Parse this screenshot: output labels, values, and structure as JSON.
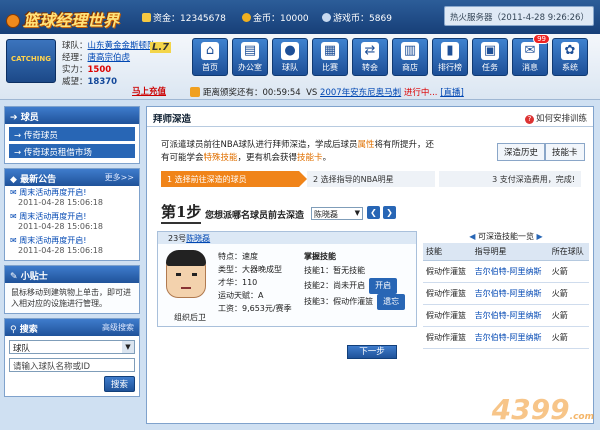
{
  "topbar": {
    "logo": "篮球经理世界",
    "funds_label": "资金：",
    "funds_value": "12345678",
    "gold_label": "金币：",
    "gold_value": "10000",
    "coins_label": "游戏币：",
    "coins_value": "5869",
    "server": "热火服务器（2011-4-28 9:26:26）"
  },
  "club": {
    "avatar_text": "CATCHING",
    "team_label": "球队：",
    "team_name": "山东黄金金斯顿队",
    "level": "L.7",
    "manager_label": "经理：",
    "manager_name": "唐高宗伯虎",
    "strength_label": "实力：",
    "strength_value": "1500",
    "prestige_label": "威望：",
    "prestige_value": "18370",
    "go_link": "马上充值"
  },
  "nav": [
    {
      "label": "首页",
      "icon": "home-icon",
      "glyph": "⌂"
    },
    {
      "label": "办公室",
      "icon": "office-icon",
      "glyph": "▤"
    },
    {
      "label": "球队",
      "icon": "basketball-icon",
      "glyph": "●"
    },
    {
      "label": "比赛",
      "icon": "match-icon",
      "glyph": "▦"
    },
    {
      "label": "转会",
      "icon": "transfer-icon",
      "glyph": "⇄"
    },
    {
      "label": "商店",
      "icon": "shop-icon",
      "glyph": "▥"
    },
    {
      "label": "排行榜",
      "icon": "ranking-icon",
      "glyph": "▮"
    },
    {
      "label": "任务",
      "icon": "task-icon",
      "glyph": "▣"
    },
    {
      "label": "消息",
      "icon": "message-icon",
      "glyph": "✉",
      "badge": "99"
    },
    {
      "label": "系统",
      "icon": "system-icon",
      "glyph": "✿"
    }
  ],
  "status": {
    "countdown_label": "距离颁奖还有：",
    "countdown": "00:59:54",
    "vs_prefix": "VS",
    "vs_link": "2007年安东尼奥马刺",
    "vs_state": "进行中...",
    "vs_detail": "[直播]"
  },
  "sidebar": {
    "players_title": "球员",
    "players_items": [
      "传奇球员",
      "传奇球员租借市场"
    ],
    "notice_title": "最新公告",
    "notice_more": "更多>>",
    "notices": [
      {
        "title": "周末活动再度开启!",
        "date": "2011-04-28 15:06:18"
      },
      {
        "title": "周末活动再度开启!",
        "date": "2011-04-28 15:06:18"
      },
      {
        "title": "周末活动再度开启!",
        "date": "2011-04-28 15:06:18"
      }
    ],
    "tips_title": "小贴士",
    "tips_text": "鼠标移动到建筑物上单击，即可进入相对应的设施进行管理。",
    "search_title": "搜索",
    "search_adv": "高级搜索",
    "search_select": "球队",
    "search_placeholder": "请输入球队名称或ID",
    "search_button": "搜索"
  },
  "main": {
    "title": "拜师深造",
    "help": "如何安排训练",
    "desc_1": "可派遣球员前往NBA球队进行拜师深造，学成后球员",
    "desc_hl": "属性",
    "desc_2": "将有所提升，还有可能学会",
    "desc_hl2": "特殊技能",
    "desc_3": "，更有机会获得",
    "desc_hl3": "技能卡",
    "desc_4": "。",
    "tab_history": "深造历史",
    "tab_cards": "技能卡",
    "steps": [
      "1 选择前往深造的球员",
      "2 选择指导的NBA明星",
      "3 支付深造费用，完成!"
    ],
    "step_big": "第1步",
    "question": "您想派哪名球员前去深造",
    "player_select": "陈晓磊",
    "player": {
      "number_name_prefix": "23号",
      "name": "陈晓磊",
      "feature": "特点：速度",
      "type": "类型：大器晚成型",
      "ability": "才华：110",
      "stamina": "运动天赋：A",
      "salary": "工资：9,653元/赛季",
      "position": "组织后卫"
    },
    "skills": {
      "title": "掌握技能",
      "items": [
        {
          "label": "技能1：",
          "value": "暂无技能",
          "button": ""
        },
        {
          "label": "技能2：",
          "value": "尚未开启",
          "button": "开启"
        },
        {
          "label": "技能3：",
          "value": "假动作灌篮",
          "button": "遗忘"
        }
      ]
    },
    "learnable": {
      "title": "可深造技能一览",
      "headers": [
        "技能",
        "指导明星",
        "所在球队"
      ],
      "rows": [
        [
          "假动作灌篮",
          "吉尔伯特-阿里纳斯",
          "火箭"
        ],
        [
          "假动作灌篮",
          "吉尔伯特-阿里纳斯",
          "火箭"
        ],
        [
          "假动作灌篮",
          "吉尔伯特-阿里纳斯",
          "火箭"
        ],
        [
          "假动作灌篮",
          "吉尔伯特-阿里纳斯",
          "火箭"
        ]
      ]
    },
    "next_button": "下一步"
  },
  "watermark": "4399",
  "watermark_sub": ".com"
}
